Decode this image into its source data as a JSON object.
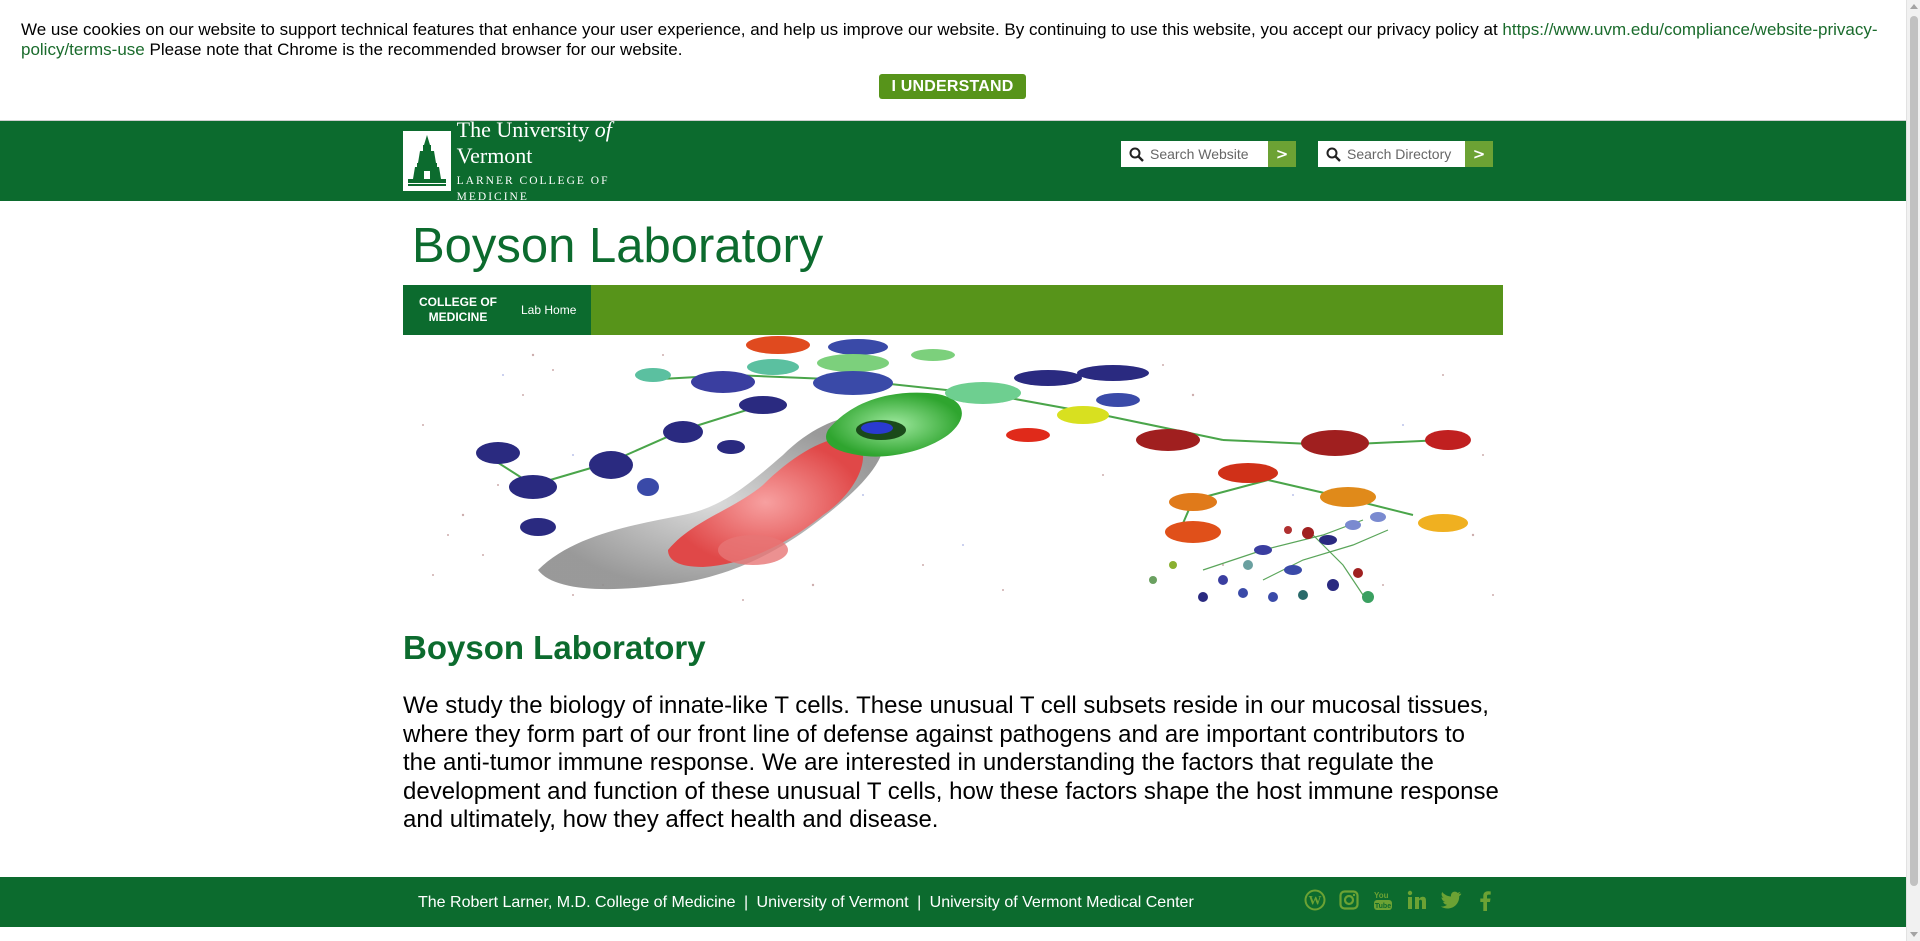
{
  "cookie_banner": {
    "text_before_link": "We use cookies on our website to support technical features that enhance your user experience, and help us improve our website. By continuing to use this website, you accept our privacy policy at ",
    "policy_link": "https://www.uvm.edu/compliance/website-privacy-policy/terms-use",
    "text_after_link": " Please note that Chrome is the recommended browser for our website.",
    "button_label": "I UNDERSTAND"
  },
  "header": {
    "logo_line1_a": "The University ",
    "logo_line1_of": "of",
    "logo_line1_b": " Vermont",
    "logo_line2": "LARNER COLLEGE OF MEDICINE",
    "search_website_placeholder": "Search Website",
    "search_directory_placeholder": "Search Directory",
    "go_label": ">"
  },
  "site_title": "Boyson Laboratory",
  "nav": {
    "college_line1": "COLLEGE OF",
    "college_line2": "MEDICINE",
    "home_label": "Lab Home"
  },
  "content": {
    "heading": "Boyson Laboratory",
    "body": "We study the biology of innate-like T cells. These unusual T cell subsets reside in our mucosal tissues, where they form part of our front line of defense against pathogens and are important contributors to the anti-tumor immune response. We are interested in understanding the factors that regulate the development and function of these unusual T cells, how these factors shape the host immune response and ultimately, how they affect health and disease."
  },
  "footer": {
    "link1": "The Robert Larner, M.D. College of Medicine",
    "link2": "University of Vermont",
    "link3": "University of Vermont Medical Center",
    "separator": "|",
    "social_icons": [
      "wordpress-icon",
      "instagram-icon",
      "youtube-icon",
      "linkedin-icon",
      "twitter-icon",
      "facebook-icon"
    ]
  },
  "colors": {
    "brand_green": "#0c6b2e",
    "accent_green": "#57941a"
  }
}
